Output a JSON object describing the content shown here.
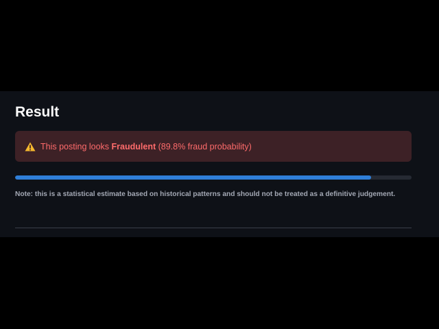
{
  "result": {
    "title": "Result",
    "alert": {
      "icon": "warning-icon",
      "prefix": "This posting looks ",
      "verdict": "Fraudulent",
      "suffix": " (89.8% fraud probability)",
      "text_color": "#ff6b6b",
      "background_color": "#3d2126"
    },
    "progress": {
      "value": 0.898,
      "fill_color": "#2f7fd8",
      "track_color": "#262a33"
    },
    "note": "Note: this is a statistical estimate based on historical patterns and should not be treated as a definitive judgement."
  }
}
